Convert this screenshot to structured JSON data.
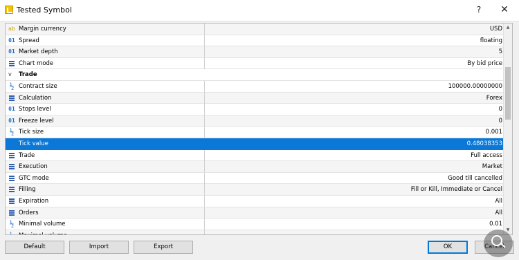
{
  "window": {
    "title": "Tested Symbol",
    "help": "?",
    "close": "✕"
  },
  "rows": [
    {
      "icon": "ab",
      "icon_name": "text-type-icon",
      "name": "Margin currency",
      "value": "USD"
    },
    {
      "icon": "01",
      "icon_name": "integer-type-icon",
      "name": "Spread",
      "value": "floating"
    },
    {
      "icon": "01",
      "icon_name": "integer-type-icon",
      "name": "Market depth",
      "value": "5"
    },
    {
      "icon": "list",
      "icon_name": "enum-type-icon",
      "name": "Chart mode",
      "value": "By bid price"
    },
    {
      "group": true,
      "name": "Trade",
      "chevron": "v"
    },
    {
      "icon": "½",
      "icon_name": "fraction-type-icon",
      "name": "Contract size",
      "value": "100000.00000000"
    },
    {
      "icon": "list",
      "icon_name": "enum-type-icon",
      "name": "Calculation",
      "value": "Forex"
    },
    {
      "icon": "01",
      "icon_name": "integer-type-icon",
      "name": "Stops level",
      "value": "0"
    },
    {
      "icon": "01",
      "icon_name": "integer-type-icon",
      "name": "Freeze level",
      "value": "0"
    },
    {
      "icon": "½",
      "icon_name": "fraction-type-icon",
      "name": "Tick size",
      "value": "0.001"
    },
    {
      "icon": "",
      "icon_name": "fraction-type-icon",
      "name": "Tick value",
      "value": "0.48038353",
      "selected": true
    },
    {
      "icon": "list",
      "icon_name": "enum-type-icon",
      "name": "Trade",
      "value": "Full access"
    },
    {
      "icon": "list",
      "icon_name": "enum-type-icon",
      "name": "Execution",
      "value": "Market"
    },
    {
      "icon": "list",
      "icon_name": "enum-type-icon",
      "name": "GTC mode",
      "value": "Good till cancelled"
    },
    {
      "icon": "list",
      "icon_name": "enum-type-icon",
      "name": "Filling",
      "value": "Fill or Kill, Immediate or Cancel"
    },
    {
      "icon": "list",
      "icon_name": "enum-type-icon",
      "name": "Expiration",
      "value": "All"
    },
    {
      "icon": "list",
      "icon_name": "enum-type-icon",
      "name": "Orders",
      "value": "All"
    },
    {
      "icon": "½",
      "icon_name": "fraction-type-icon",
      "name": "Minimal volume",
      "value": "0.01"
    },
    {
      "icon": "½",
      "icon_name": "fraction-type-icon",
      "name": "Maximal volume",
      "value": ""
    }
  ],
  "buttons": {
    "default": "Default",
    "import": "Import",
    "export": "Export",
    "ok": "OK",
    "cancel": "Cancel"
  },
  "colors": {
    "selection": "#0b78d7",
    "accent": "#0078d7"
  }
}
